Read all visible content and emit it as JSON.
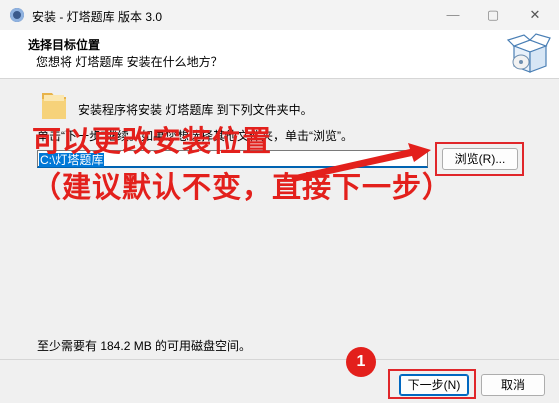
{
  "window": {
    "title": "安装 - 灯塔题库 版本 3.0"
  },
  "header": {
    "title": "选择目标位置",
    "subtitle": "您想将 灯塔题库 安装在什么地方？"
  },
  "content": {
    "intro": "安装程序将安装 灯塔题库 到下列文件夹中。",
    "hint": "单击“下一步”继续。如果您想选择其他文件夹，单击“浏览”。",
    "path_value": "C:\\灯塔题库",
    "browse_label": "浏览(R)...",
    "space_required": "至少需要有 184.2 MB 的可用磁盘空间。"
  },
  "footer": {
    "next_label": "下一步(N)",
    "cancel_label": "取消"
  },
  "annotations": {
    "line1": "可以更改安装位置",
    "line2": "（建议默认不变，直接下一步）",
    "step_number": "1",
    "color": "#e3201c"
  }
}
